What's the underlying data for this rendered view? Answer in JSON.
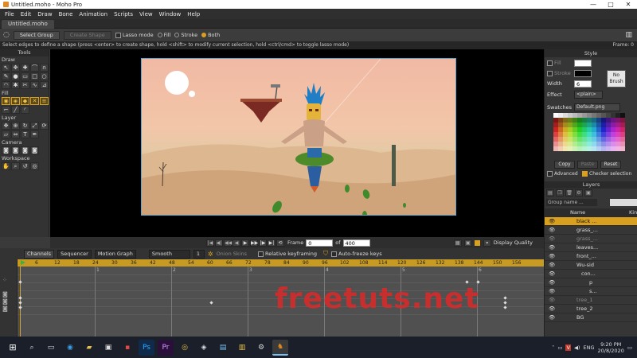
{
  "window": {
    "title": "Untitled.moho - Moho Pro",
    "minimize": "—",
    "maximize": "□",
    "close": "✕"
  },
  "menu": [
    "File",
    "Edit",
    "Draw",
    "Bone",
    "Animation",
    "Scripts",
    "View",
    "Window",
    "Help"
  ],
  "doc_tab": "Untitled.moho",
  "tool_options": {
    "select_group": "Select Group",
    "create_shape": "Create Shape",
    "lasso_mode": "Lasso mode",
    "fill": "Fill",
    "stroke": "Stroke",
    "both": "Both",
    "selected_mode": "Both"
  },
  "hint": "Select edges to define a shape (press <enter> to create shape, hold <shift> to modify current selection, hold <ctrl/cmd> to toggle lasso mode)",
  "frame_indicator": "Frame: 0",
  "tools_panel": {
    "title": "Tools",
    "sections": [
      "Draw",
      "Fill",
      "Layer",
      "Camera",
      "Workspace"
    ]
  },
  "playback": {
    "frame_label": "Frame",
    "frame_value": "0",
    "of_label": "of",
    "total_frames": "400",
    "display_quality": "Display Quality"
  },
  "timeline": {
    "tabs": [
      "Channels",
      "Sequencer",
      "Motion Graph"
    ],
    "interpolation": "Smooth",
    "interp_value": "1",
    "onion_skins": "Onion Skins",
    "relative_keyframing": "Relative keyframing",
    "auto_freeze": "Auto-freeze keys",
    "ruler_ticks": [
      "0",
      "6",
      "12",
      "18",
      "24",
      "30",
      "36",
      "42",
      "48",
      "54",
      "60",
      "66",
      "72",
      "78",
      "84",
      "90",
      "96",
      "102",
      "108",
      "114",
      "120",
      "126",
      "132",
      "138",
      "144",
      "150",
      "156"
    ],
    "second_markers": [
      "1",
      "2",
      "3",
      "4",
      "5",
      "6"
    ]
  },
  "style_panel": {
    "title": "Style",
    "fill_label": "Fill",
    "stroke_label": "Stroke",
    "width_label": "Width",
    "width_value": "6",
    "no_brush": "No Brush",
    "effect_label": "Effect",
    "effect_value": "<plain>",
    "swatches_label": "Swatches",
    "swatches_file": "Default.png",
    "copy": "Copy",
    "paste": "Paste",
    "reset": "Reset",
    "advanced": "Advanced",
    "checker_selection": "Checker selection"
  },
  "layers_panel": {
    "title": "Layers",
    "group_name_placeholder": "Group name ...",
    "col_name": "Name",
    "col_kind": "Kin",
    "layers": [
      {
        "name": "black ...",
        "indent": 0,
        "selected": true
      },
      {
        "name": "grass_...",
        "indent": 0,
        "selected": false
      },
      {
        "name": "grass_...",
        "indent": 0,
        "selected": false
      },
      {
        "name": "leaves...",
        "indent": 0,
        "selected": false
      },
      {
        "name": "front_...",
        "indent": 0,
        "selected": false
      },
      {
        "name": "Wu-sid",
        "indent": 0,
        "selected": false
      },
      {
        "name": "con...",
        "indent": 1,
        "selected": false
      },
      {
        "name": "p",
        "indent": 2,
        "selected": false
      },
      {
        "name": "s...",
        "indent": 2,
        "selected": false
      },
      {
        "name": "tree_1",
        "indent": 0,
        "selected": false
      },
      {
        "name": "tree_2",
        "indent": 0,
        "selected": false
      },
      {
        "name": "BG",
        "indent": 0,
        "selected": false
      }
    ]
  },
  "watermark": "freetuts.net",
  "taskbar": {
    "time": "9:20 PM",
    "date": "20/8/2020",
    "lang": "ENG"
  }
}
